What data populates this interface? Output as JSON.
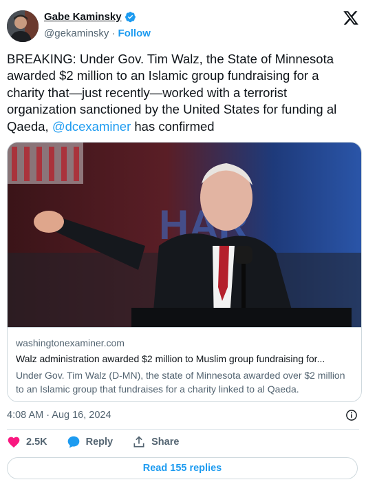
{
  "author": {
    "name": "Gabe Kaminsky",
    "handle": "@gekaminsky",
    "separator": "·",
    "follow_label": "Follow"
  },
  "tweet": {
    "text_before": "BREAKING: Under Gov. Tim Walz, the State of Minnesota awarded $2 million to an Islamic group fundraising for a charity that—just recently—worked with a terrorist organization sanctioned by the United States for funding al Qaeda, ",
    "mention": "@dcexaminer",
    "text_after": " has confirmed"
  },
  "card": {
    "domain": "washingtonexaminer.com",
    "title": "Walz administration awarded $2 million to Muslim group fundraising for...",
    "description": "Under Gov. Tim Walz (D-MN), the state of Minnesota awarded over $2 million to an Islamic group that fundraises for a charity linked to al Qaeda."
  },
  "timestamp": "4:08 AM · Aug 16, 2024",
  "actions": {
    "like_count": "2.5K",
    "reply_label": "Reply",
    "share_label": "Share"
  },
  "read_replies_label": "Read 155 replies",
  "colors": {
    "accent": "#1d9bf0",
    "like": "#f91880",
    "text": "#0f1419",
    "muted": "#536471"
  },
  "icons": [
    "verified-badge-icon",
    "x-logo-icon",
    "info-icon",
    "heart-icon",
    "reply-bubble-icon",
    "share-icon"
  ]
}
